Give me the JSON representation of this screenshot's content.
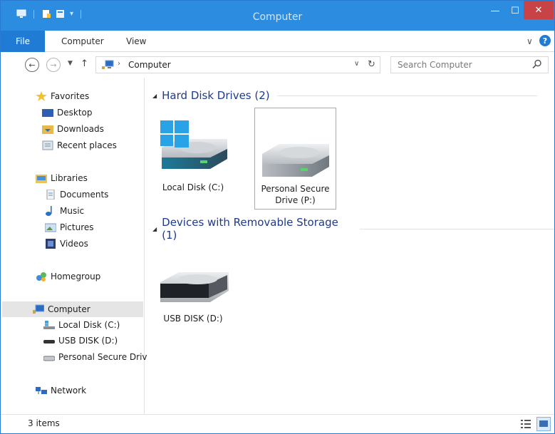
{
  "window": {
    "title": "Computer"
  },
  "ribbon": {
    "tabs": [
      {
        "label": "File"
      },
      {
        "label": "Computer"
      },
      {
        "label": "View"
      }
    ],
    "help_label": "?"
  },
  "address": {
    "path": "Computer",
    "search_placeholder": "Search Computer"
  },
  "sidebar": {
    "favorites": {
      "label": "Favorites",
      "items": [
        {
          "label": "Desktop"
        },
        {
          "label": "Downloads"
        },
        {
          "label": "Recent places"
        }
      ]
    },
    "libraries": {
      "label": "Libraries",
      "items": [
        {
          "label": "Documents"
        },
        {
          "label": "Music"
        },
        {
          "label": "Pictures"
        },
        {
          "label": "Videos"
        }
      ]
    },
    "homegroup": {
      "label": "Homegroup"
    },
    "computer": {
      "label": "Computer",
      "items": [
        {
          "label": "Local Disk (C:)"
        },
        {
          "label": "USB DISK (D:)"
        },
        {
          "label": "Personal Secure Driv"
        }
      ]
    },
    "network": {
      "label": "Network"
    }
  },
  "content": {
    "groups": [
      {
        "header": "Hard Disk Drives (2)",
        "items": [
          {
            "label": "Local Disk (C:)"
          },
          {
            "label_line1": "Personal Secure",
            "label_line2": "Drive (P:)"
          }
        ]
      },
      {
        "header": "Devices with Removable Storage (1)",
        "items": [
          {
            "label": "USB DISK (D:)"
          }
        ]
      }
    ]
  },
  "status": {
    "text": "3 items"
  },
  "colors": {
    "titlebar": "#2b8ce0",
    "file_tab": "#1f7bd4",
    "close": "#c84346",
    "group_header": "#1e3a8a"
  }
}
